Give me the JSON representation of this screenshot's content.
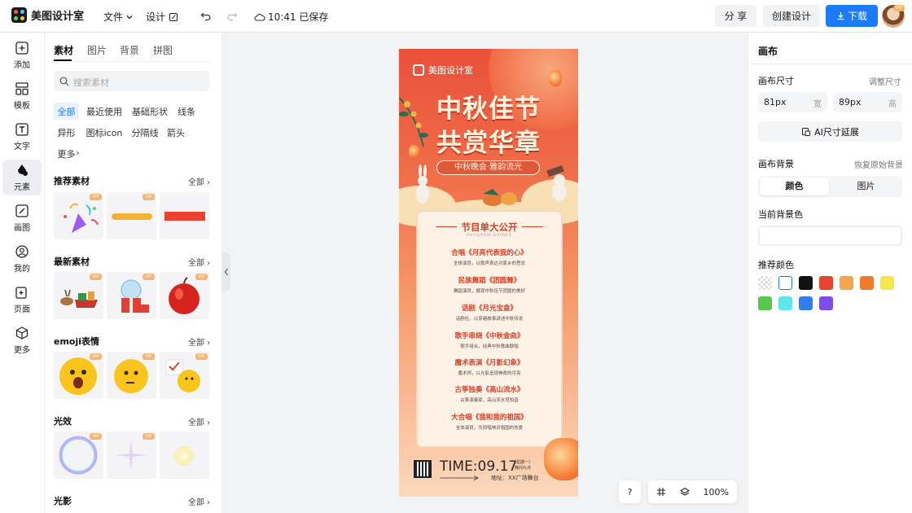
{
  "app": {
    "name": "美图设计室",
    "save_status": "10:41 已保存"
  },
  "topbar": {
    "file_label": "文件",
    "design_label": "设计",
    "share_label": "分 享",
    "create_label": "创建设计",
    "download_label": "下载",
    "vip_badge": "VIP"
  },
  "leftnav": {
    "items": [
      {
        "label": "添加",
        "icon": "plus-square-icon"
      },
      {
        "label": "模板",
        "icon": "template-icon"
      },
      {
        "label": "文字",
        "icon": "text-icon"
      },
      {
        "label": "元素",
        "icon": "shapes-icon"
      },
      {
        "label": "画图",
        "icon": "draw-icon"
      },
      {
        "label": "我的",
        "icon": "user-icon"
      },
      {
        "label": "页面",
        "icon": "page-add-icon"
      },
      {
        "label": "更多",
        "icon": "box-icon"
      }
    ],
    "active": "元素"
  },
  "panel": {
    "tabs": [
      "素材",
      "图片",
      "背景",
      "拼图"
    ],
    "active_tab": "素材",
    "search_placeholder": "搜索素材",
    "chips": [
      "全部",
      "最近使用",
      "基础形状",
      "线条",
      "异形",
      "图标icon",
      "分隔线",
      "箭头",
      "更多"
    ],
    "active_chip": "全部",
    "all_label": "全部",
    "vip": "VIP",
    "sections": [
      {
        "title": "推荐素材"
      },
      {
        "title": "最新素材"
      },
      {
        "title": "emoji表情"
      },
      {
        "title": "光效"
      },
      {
        "title": "光影"
      }
    ]
  },
  "poster": {
    "logo_text": "美图设计室",
    "title_line1": "中秋佳节",
    "title_line2": "共赏华章",
    "subtitle": "中秋晚会·雅韵流光",
    "card_title": "节目单大公开",
    "card_subtitle": "PROGRAM GUIDES",
    "programs": [
      {
        "title": "合唱《月亮代表我的心》",
        "desc": "全体演员，以歌声表达对家乡的思念"
      },
      {
        "title": "民族舞蹈《团圆舞》",
        "desc": "舞蹈演员，展现中秋佳节团圆的美好"
      },
      {
        "title": "话剧《月光宝盒》",
        "desc": "话剧社，以穿越故事讲述中秋传说"
      },
      {
        "title": "歌手串烧《中秋金曲》",
        "desc": "歌手组合，经典中秋歌曲联唱"
      },
      {
        "title": "魔术表演《月影幻象》",
        "desc": "魔术师，以光影呈现神奇的月亮"
      },
      {
        "title": "古筝独奏《高山流水》",
        "desc": "古筝演奏家，高山流水觅知音"
      },
      {
        "title": "大合唱《我和我的祖国》",
        "desc": "全体演员，共同唱响对祖国的热爱"
      }
    ],
    "time": "TIME:09.17",
    "time_side": "(星期一)\n晚间九点",
    "place": "地址：XX广场舞台"
  },
  "canvas_controls": {
    "help": "?",
    "zoom": "100%"
  },
  "right": {
    "title": "画布",
    "size_label": "画布尺寸",
    "adjust_label": "调整尺寸",
    "width_value": "81px",
    "width_unit": "宽",
    "height_value": "89px",
    "height_unit": "高",
    "ai_extend": "AI尺寸延展",
    "bg_label": "画布背景",
    "restore_label": "恢复原始背景",
    "seg_color": "颜色",
    "seg_image": "图片",
    "current_bg_label": "当前背景色",
    "recommend_label": "推荐颜色",
    "swatches": [
      "transparent",
      "#ffffff",
      "#111111",
      "#e8432e",
      "#f4a64a",
      "#f07b2f",
      "#f6e84a",
      "#57c84b",
      "#5ee6ea",
      "#2f7ff0",
      "#7d4ee8"
    ]
  }
}
